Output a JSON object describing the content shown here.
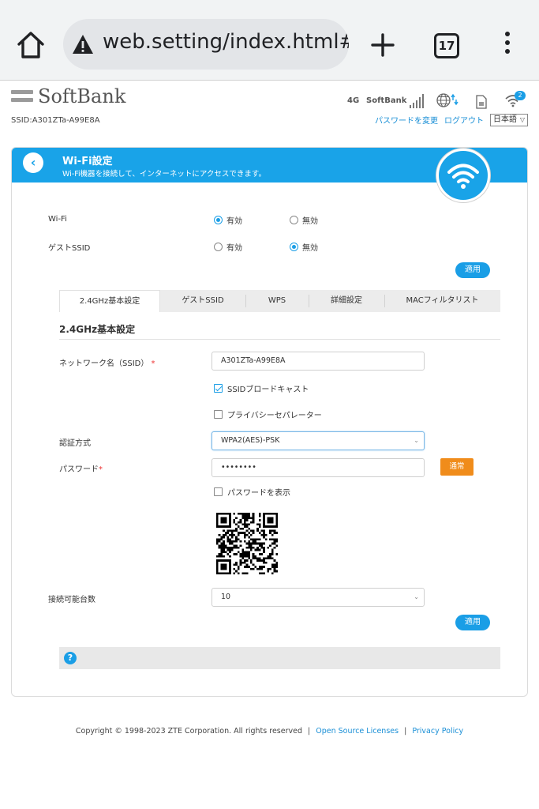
{
  "browser": {
    "url": "web.setting/index.html#w",
    "tab_count": "17"
  },
  "header": {
    "brand": "SoftBank",
    "ssid_label": "SSID:A301ZTa-A99E8A",
    "network_type": "4G",
    "carrier": "SoftBank",
    "notification_count": "2",
    "change_password_link": "パスワードを変更",
    "logout_link": "ログアウト",
    "language": "日本語"
  },
  "banner": {
    "title": "Wi-Fi設定",
    "subtitle": "Wi-Fi機器を接続して、インターネットにアクセスできます。"
  },
  "wifi_toggle": {
    "label": "Wi-Fi",
    "options": [
      "有効",
      "無効"
    ],
    "selected": "有効"
  },
  "guest_ssid_toggle": {
    "label": "ゲストSSID",
    "options": [
      "有効",
      "無効"
    ],
    "selected": "無効"
  },
  "apply_label": "適用",
  "tabs": [
    {
      "label": "2.4GHz基本設定",
      "active": true
    },
    {
      "label": "ゲストSSID",
      "active": false
    },
    {
      "label": "WPS",
      "active": false
    },
    {
      "label": "詳細設定",
      "active": false
    },
    {
      "label": "MACフィルタリスト",
      "active": false
    }
  ],
  "section_title": "2.4GHz基本設定",
  "form": {
    "network_name_label": "ネットワーク名（SSID）",
    "network_name_value": "A301ZTa-A99E8A",
    "ssid_broadcast_label": "SSIDブロードキャスト",
    "ssid_broadcast_checked": true,
    "privacy_separator_label": "プライバシーセパレーター",
    "privacy_separator_checked": false,
    "auth_label": "認証方式",
    "auth_value": "WPA2(AES)-PSK",
    "password_label": "パスワード",
    "password_value": "••••••••",
    "password_mode_button": "通常",
    "show_password_label": "パスワードを表示",
    "show_password_checked": false,
    "max_clients_label": "接続可能台数",
    "max_clients_value": "10",
    "required_mark": "*"
  },
  "help_icon": "?",
  "footer": {
    "copyright": "Copyright © 1998-2023 ZTE Corporation. All rights reserved",
    "separator": "|",
    "open_source_link": "Open Source Licenses",
    "privacy_link": "Privacy Policy"
  },
  "colors": {
    "accent": "#19a3e8",
    "warning_button": "#f08c1b",
    "link": "#1a8fd6"
  }
}
